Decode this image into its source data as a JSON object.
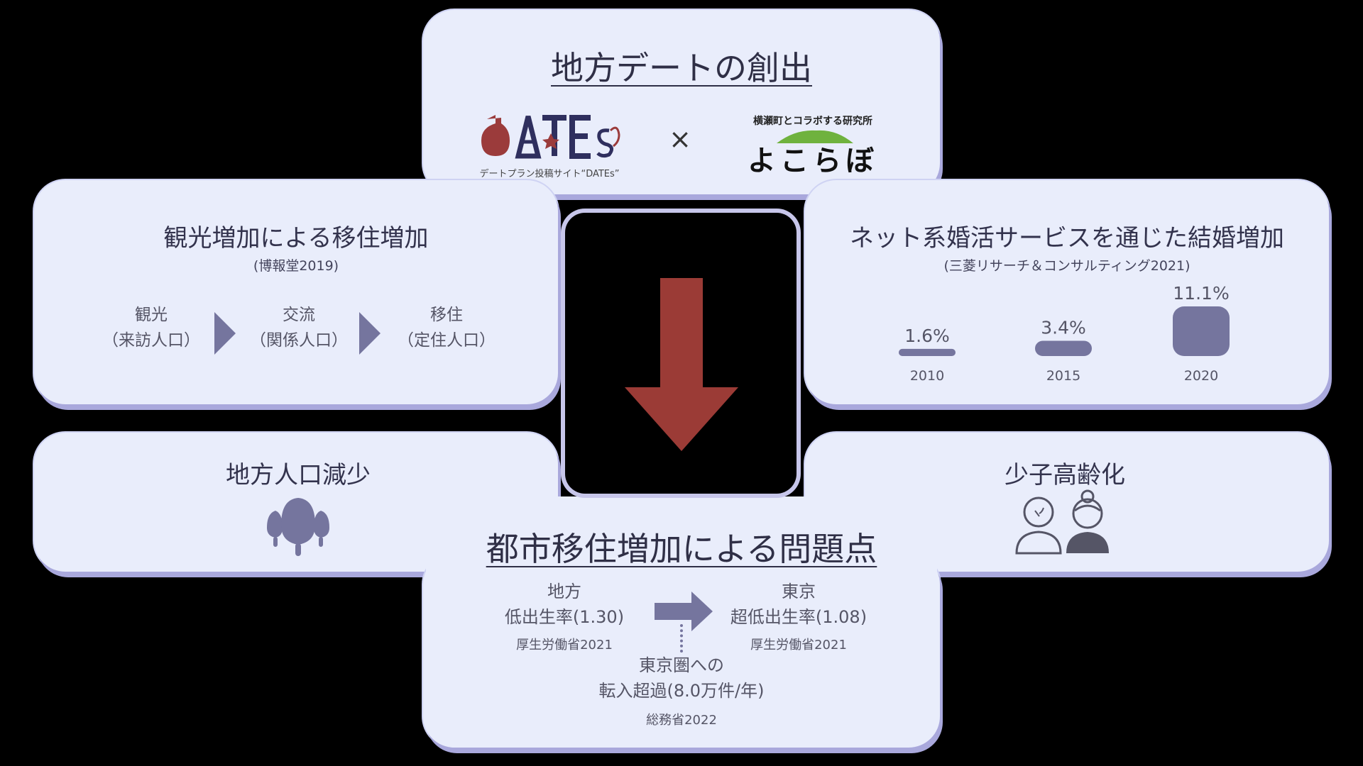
{
  "top": {
    "title": "地方デートの創出",
    "dates_logo_text": "DATEs",
    "dates_caption": "デートプラン投稿サイト“DATEs”",
    "cross": "×",
    "yokolab_arc": "横瀬町とコラボする研究所",
    "yokolab_name": "よこらぼ"
  },
  "left_panel": {
    "title": "観光増加による移住増加",
    "source": "(博報堂2019)",
    "steps": [
      {
        "line1": "観光",
        "line2": "（来訪人口）"
      },
      {
        "line1": "交流",
        "line2": "（関係人口）"
      },
      {
        "line1": "移住",
        "line2": "（定住人口）"
      }
    ]
  },
  "right_panel": {
    "title": "ネット系婚活サービスを通じた結婚増加",
    "source": "(三菱リサーチ＆コンサルティング2021)",
    "chart_data": {
      "type": "bar",
      "categories": [
        "2010",
        "2015",
        "2020"
      ],
      "values": [
        1.6,
        3.4,
        11.1
      ],
      "value_labels": [
        "1.6%",
        "3.4%",
        "11.1%"
      ],
      "unit": "%"
    }
  },
  "bottom_left": {
    "title": "地方人口減少",
    "icon": "population-decline-icon"
  },
  "bottom_right": {
    "title": "少子高齢化",
    "icon": "elderly-couple-icon"
  },
  "bottom": {
    "title": "都市移住増加による問題点",
    "local_label": "地方",
    "local_rate": "低出生率(1.30)",
    "local_source": "厚生労働省2021",
    "tokyo_label": "東京",
    "tokyo_rate": "超低出生率(1.08)",
    "tokyo_source": "厚生労働省2021",
    "migration_line1": "東京圏への",
    "migration_line2": "転入超過(8.0万件/年)",
    "migration_source": "総務省2022"
  },
  "colors": {
    "panel": "#e9edfb",
    "panel_shadow": "#a9a8dc",
    "accent": "#75759e",
    "down_arrow": "#9b3b36",
    "logo_red": "#9b3b3b",
    "logo_navy": "#2f2f5e",
    "yokolab_green": "#6fb23e"
  }
}
